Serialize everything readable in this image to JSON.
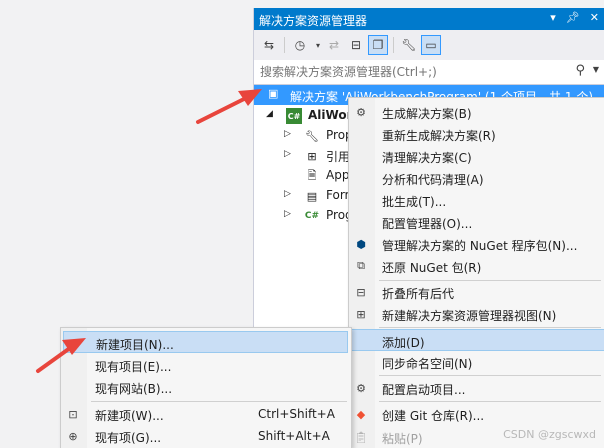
{
  "solution_explorer": {
    "title": "解决方案资源管理器",
    "title_buttons": [
      "▾",
      "ꟷ",
      "✕"
    ],
    "search_placeholder": "搜索解决方案资源管理器(Ctrl+;)",
    "root_label": "解决方案 'AliWorkbenchProgram' (1 个项目，共 1 个)",
    "project_label": "AliWor",
    "tree_items": [
      "Prop",
      "引用",
      "App",
      "Form",
      "Prog"
    ]
  },
  "context_menu": {
    "items": [
      {
        "label": "生成解决方案(B)",
        "icon": "build-icon"
      },
      {
        "label": "重新生成解决方案(R)",
        "icon": ""
      },
      {
        "label": "清理解决方案(C)",
        "icon": ""
      },
      {
        "label": "分析和代码清理(A)",
        "icon": ""
      },
      {
        "label": "批生成(T)...",
        "icon": ""
      },
      {
        "label": "配置管理器(O)...",
        "icon": ""
      },
      {
        "label": "管理解决方案的 NuGet 程序包(N)...",
        "icon": "nuget-icon"
      },
      {
        "label": "还原 NuGet 包(R)",
        "icon": "restore-icon"
      },
      {
        "label": "折叠所有后代",
        "icon": "collapse-icon"
      },
      {
        "label": "新建解决方案资源管理器视图(N)",
        "icon": "new-view-icon"
      },
      {
        "label": "添加(D)",
        "icon": ""
      },
      {
        "label": "同步命名空间(N)",
        "icon": ""
      },
      {
        "label": "配置启动项目...",
        "icon": "gear-icon"
      },
      {
        "label": "创建 Git 仓库(R)...",
        "icon": "git-icon"
      },
      {
        "label": "粘贴(P)",
        "icon": "paste-icon"
      }
    ]
  },
  "submenu": {
    "items": [
      {
        "label": "新建项目(N)...",
        "shortcut": ""
      },
      {
        "label": "现有项目(E)...",
        "shortcut": ""
      },
      {
        "label": "现有网站(B)...",
        "shortcut": ""
      },
      {
        "label": "新建项(W)...",
        "shortcut": "Ctrl+Shift+A"
      },
      {
        "label": "现有项(G)...",
        "shortcut": "Shift+Alt+A"
      }
    ]
  },
  "watermark": "CSDN @zgscwxd",
  "colors": {
    "accent": "#007acc",
    "highlight": "#c9def5",
    "selection": "#3399ff",
    "arrow": "#e8453c"
  }
}
